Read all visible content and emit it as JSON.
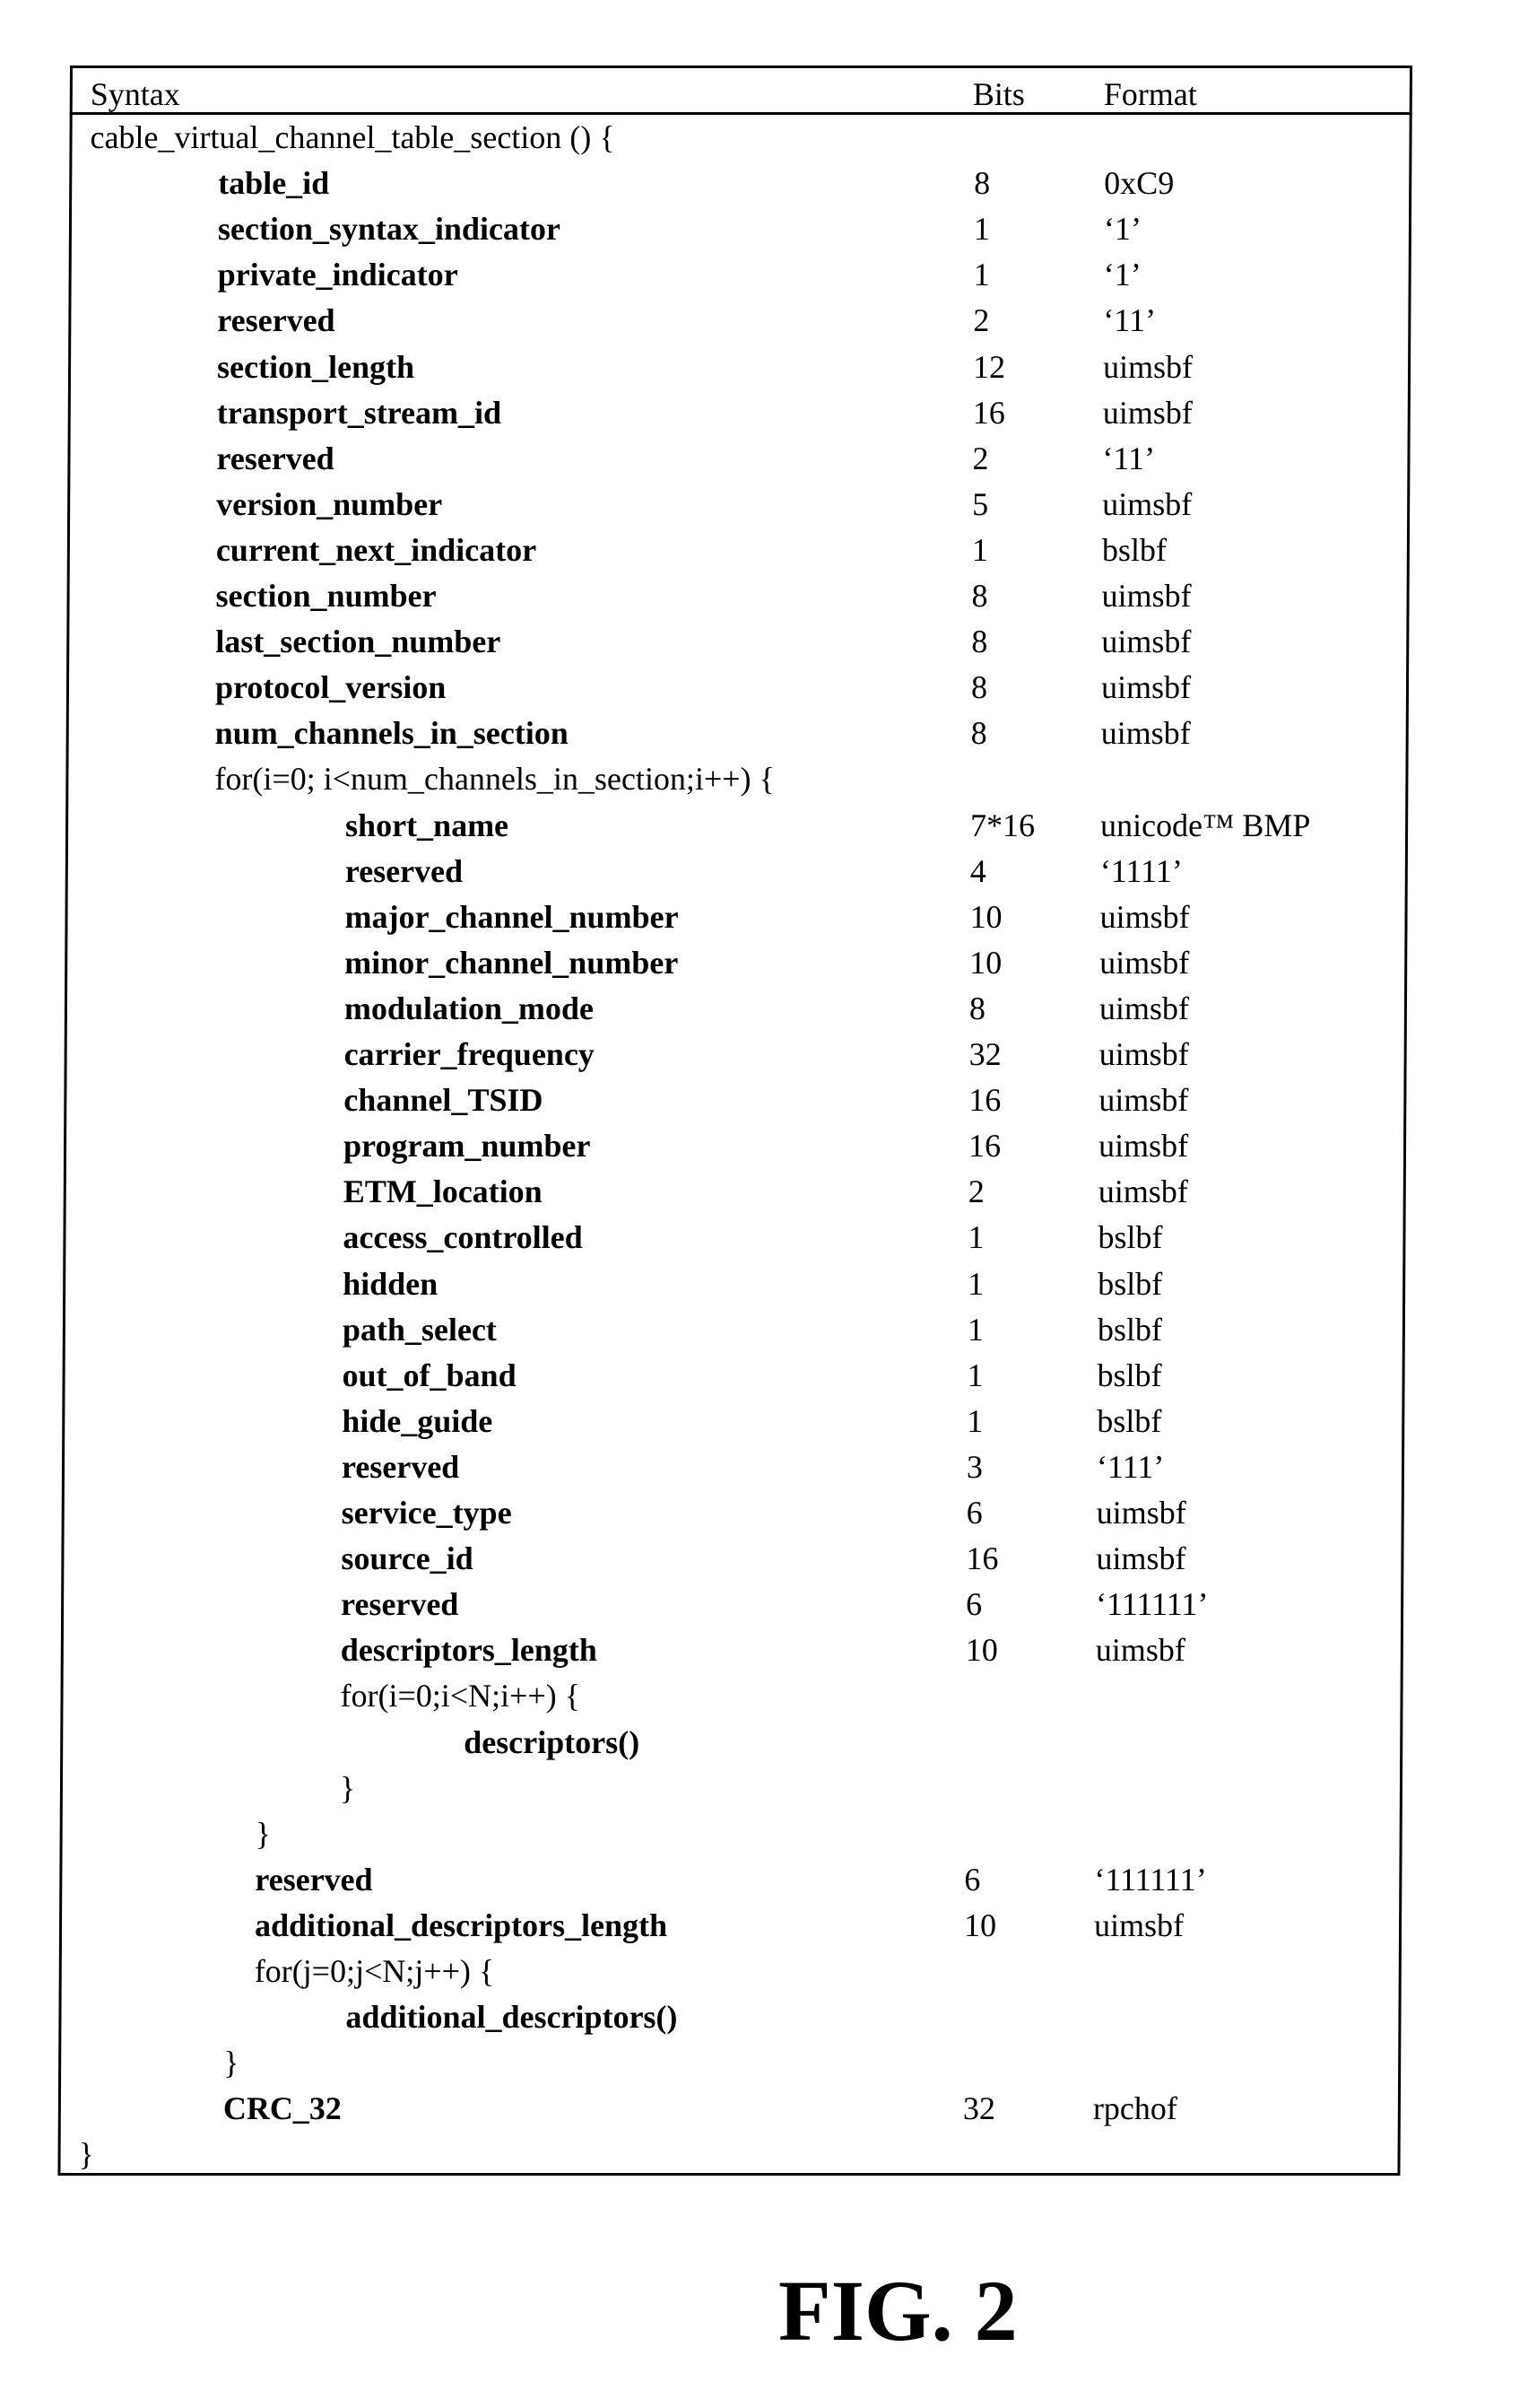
{
  "table": {
    "headers": {
      "syntax": "Syntax",
      "bits": "Bits",
      "format": "Format"
    },
    "rows": [
      {
        "syntax": "cable_virtual_channel_table_section () {",
        "bits": "",
        "format": "",
        "level": 0,
        "bold": false
      },
      {
        "syntax": "table_id",
        "bits": "8",
        "format": "0xC9",
        "level": 1,
        "bold": true
      },
      {
        "syntax": "section_syntax_indicator",
        "bits": "1",
        "format": "‘1’",
        "level": 1,
        "bold": true
      },
      {
        "syntax": "private_indicator",
        "bits": "1",
        "format": "‘1’",
        "level": 1,
        "bold": true
      },
      {
        "syntax": "reserved",
        "bits": "2",
        "format": "‘11’",
        "level": 1,
        "bold": true
      },
      {
        "syntax": "section_length",
        "bits": "12",
        "format": "uimsbf",
        "level": 1,
        "bold": true
      },
      {
        "syntax": "transport_stream_id",
        "bits": "16",
        "format": "uimsbf",
        "level": 1,
        "bold": true
      },
      {
        "syntax": "reserved",
        "bits": "2",
        "format": "‘11’",
        "level": 1,
        "bold": true
      },
      {
        "syntax": "version_number",
        "bits": "5",
        "format": "uimsbf",
        "level": 1,
        "bold": true
      },
      {
        "syntax": "current_next_indicator",
        "bits": "1",
        "format": "bslbf",
        "level": 1,
        "bold": true
      },
      {
        "syntax": "section_number",
        "bits": "8",
        "format": "uimsbf",
        "level": 1,
        "bold": true
      },
      {
        "syntax": "last_section_number",
        "bits": "8",
        "format": "uimsbf",
        "level": 1,
        "bold": true
      },
      {
        "syntax": "protocol_version",
        "bits": "8",
        "format": "uimsbf",
        "level": 1,
        "bold": true
      },
      {
        "syntax": "num_channels_in_section",
        "bits": "8",
        "format": "uimsbf",
        "level": 1,
        "bold": true
      },
      {
        "syntax": "for(i=0; i<num_channels_in_section;i++) {",
        "bits": "",
        "format": "",
        "level": 1,
        "bold": false
      },
      {
        "syntax": "short_name",
        "bits": "7*16",
        "format": "unicode™ BMP",
        "level": 2,
        "bold": true
      },
      {
        "syntax": "reserved",
        "bits": "4",
        "format": "‘1111’",
        "level": 2,
        "bold": true
      },
      {
        "syntax": "major_channel_number",
        "bits": "10",
        "format": "uimsbf",
        "level": 2,
        "bold": true
      },
      {
        "syntax": "minor_channel_number",
        "bits": "10",
        "format": "uimsbf",
        "level": 2,
        "bold": true
      },
      {
        "syntax": "modulation_mode",
        "bits": "8",
        "format": "uimsbf",
        "level": 2,
        "bold": true
      },
      {
        "syntax": "carrier_frequency",
        "bits": "32",
        "format": "uimsbf",
        "level": 2,
        "bold": true
      },
      {
        "syntax": "channel_TSID",
        "bits": "16",
        "format": "uimsbf",
        "level": 2,
        "bold": true
      },
      {
        "syntax": "program_number",
        "bits": "16",
        "format": "uimsbf",
        "level": 2,
        "bold": true
      },
      {
        "syntax": "ETM_location",
        "bits": "2",
        "format": "uimsbf",
        "level": 2,
        "bold": true
      },
      {
        "syntax": "access_controlled",
        "bits": "1",
        "format": "bslbf",
        "level": 2,
        "bold": true
      },
      {
        "syntax": "hidden",
        "bits": "1",
        "format": "bslbf",
        "level": 2,
        "bold": true
      },
      {
        "syntax": "path_select",
        "bits": "1",
        "format": "bslbf",
        "level": 2,
        "bold": true
      },
      {
        "syntax": "out_of_band",
        "bits": "1",
        "format": "bslbf",
        "level": 2,
        "bold": true
      },
      {
        "syntax": "hide_guide",
        "bits": "1",
        "format": "bslbf",
        "level": 2,
        "bold": true
      },
      {
        "syntax": "reserved",
        "bits": "3",
        "format": "‘111’",
        "level": 2,
        "bold": true
      },
      {
        "syntax": "service_type",
        "bits": "6",
        "format": "uimsbf",
        "level": 2,
        "bold": true
      },
      {
        "syntax": "source_id",
        "bits": "16",
        "format": "uimsbf",
        "level": 2,
        "bold": true
      },
      {
        "syntax": "reserved",
        "bits": "6",
        "format": "‘111111’",
        "level": 2,
        "bold": true
      },
      {
        "syntax": "descriptors_length",
        "bits": "10",
        "format": "uimsbf",
        "level": 2,
        "bold": true
      },
      {
        "syntax": "for(i=0;i<N;i++) {",
        "bits": "",
        "format": "",
        "level": 2,
        "bold": false
      },
      {
        "syntax": "descriptors()",
        "bits": "",
        "format": "",
        "level": 3,
        "bold": true
      },
      {
        "syntax": "}",
        "bits": "",
        "format": "",
        "level": 2,
        "bold": false
      },
      {
        "syntax": "}",
        "bits": "",
        "format": "",
        "level": 1.4,
        "bold": false
      },
      {
        "syntax": "reserved",
        "bits": "6",
        "format": "‘111111’",
        "level": 1.4,
        "bold": true
      },
      {
        "syntax": "additional_descriptors_length",
        "bits": "10",
        "format": "uimsbf",
        "level": 1.4,
        "bold": true
      },
      {
        "syntax": "for(j=0;j<N;j++) {",
        "bits": "",
        "format": "",
        "level": 1.4,
        "bold": false
      },
      {
        "syntax": "additional_descriptors()",
        "bits": "",
        "format": "",
        "level": 2.1,
        "bold": true
      },
      {
        "syntax": "}",
        "bits": "",
        "format": "",
        "level": 1.15,
        "bold": false
      },
      {
        "syntax": "CRC_32",
        "bits": "32",
        "format": "rpchof",
        "level": 1.15,
        "bold": true
      },
      {
        "syntax": "}",
        "bits": "",
        "format": "",
        "level": 0,
        "bold": false
      }
    ]
  },
  "caption": "FIG. 2"
}
